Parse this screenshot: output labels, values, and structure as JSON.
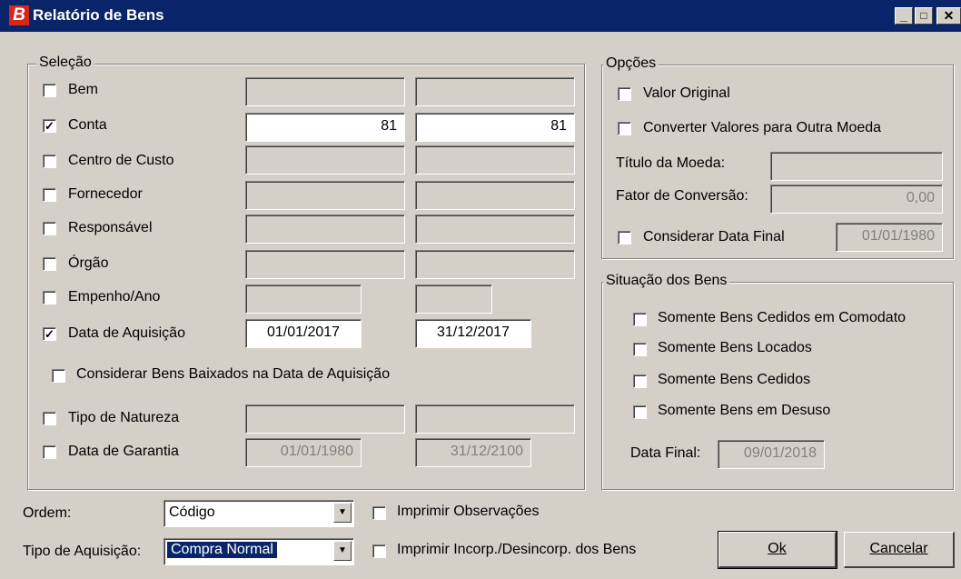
{
  "window": {
    "icon_letter": "B",
    "title": "Relatório de Bens",
    "minimize": "_",
    "maximize": "□",
    "close": "✕"
  },
  "selecao": {
    "legend": "Seleção",
    "bem": {
      "label": "Bem",
      "checked": false
    },
    "conta": {
      "label": "Conta",
      "checked": true,
      "from": "81",
      "to": "81"
    },
    "centro": {
      "label": "Centro de Custo",
      "checked": false
    },
    "fornecedor": {
      "label": "Fornecedor",
      "checked": false
    },
    "responsavel": {
      "label": "Responsável",
      "checked": false
    },
    "orgao": {
      "label": "Órgão",
      "checked": false
    },
    "empenho": {
      "label": "Empenho/Ano",
      "checked": false
    },
    "aquisicao": {
      "label": "Data de Aquisição",
      "checked": true,
      "from": "01/01/2017",
      "to": "31/12/2017"
    },
    "baixados": {
      "label": "Considerar Bens Baixados na Data de Aquisição",
      "checked": false
    },
    "natureza": {
      "label": "Tipo de Natureza",
      "checked": false
    },
    "garantia": {
      "label": "Data de Garantia",
      "checked": false,
      "from": "01/01/1980",
      "to": "31/12/2100"
    }
  },
  "opcoes": {
    "legend": "Opções",
    "valor_original": {
      "label": "Valor Original",
      "checked": false
    },
    "converter": {
      "label": "Converter Valores para Outra Moeda",
      "checked": false
    },
    "titulo_moeda": {
      "label": "Título da Moeda:",
      "value": ""
    },
    "fator": {
      "label": "Fator de Conversão:",
      "value": "0,00"
    },
    "data_final": {
      "label": "Considerar Data Final",
      "checked": false,
      "value": "01/01/1980"
    }
  },
  "situacao": {
    "legend": "Situação dos Bens",
    "comodato": {
      "label": "Somente Bens Cedidos em Comodato",
      "checked": false
    },
    "locados": {
      "label": "Somente Bens Locados",
      "checked": false
    },
    "cedidos": {
      "label": "Somente Bens Cedidos",
      "checked": false
    },
    "desuso": {
      "label": "Somente Bens em Desuso",
      "checked": false
    },
    "data_final": {
      "label": "Data Final:",
      "value": "09/01/2018"
    }
  },
  "footer": {
    "ordem": {
      "label": "Ordem:",
      "value": "Código"
    },
    "tipo": {
      "label": "Tipo de Aquisição:",
      "value": "Compra Normal"
    },
    "obs": {
      "label": "Imprimir Observações",
      "checked": false
    },
    "incorp": {
      "label": "Imprimir Incorp./Desincorp. dos Bens",
      "checked": false
    },
    "ok": "Ok",
    "cancelar": "Cancelar"
  }
}
